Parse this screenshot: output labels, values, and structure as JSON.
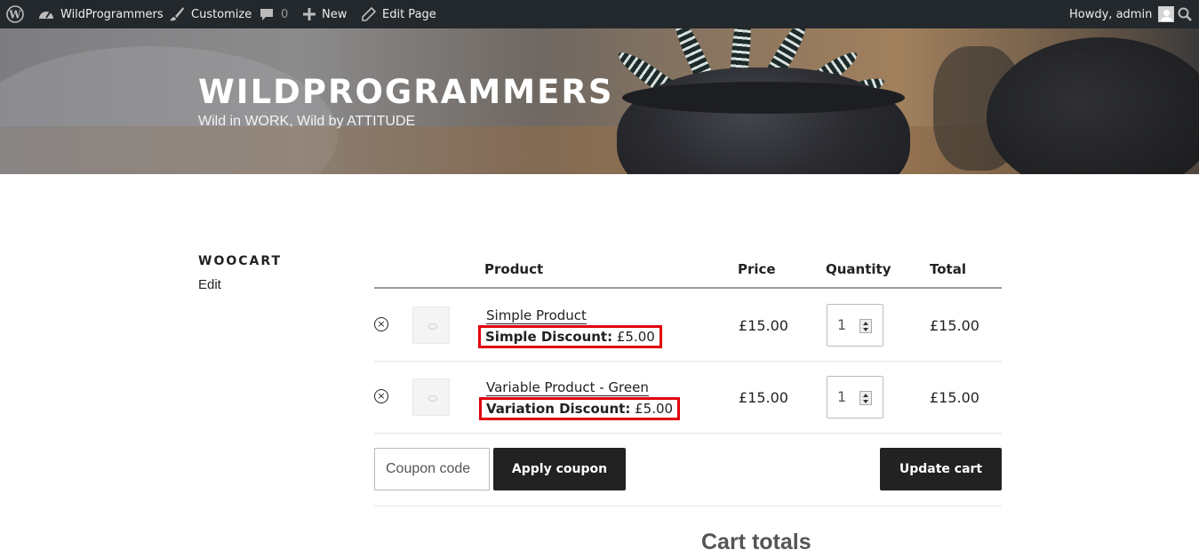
{
  "adminbar": {
    "site_name": "WildProgrammers",
    "customize": "Customize",
    "comments_count": "0",
    "new": "New",
    "edit_page": "Edit Page",
    "howdy": "Howdy, admin",
    "icons": [
      "wordpress-icon",
      "dashboard-icon",
      "brush-icon",
      "comment-icon",
      "plus-icon",
      "pencil-icon",
      "avatar",
      "search-icon"
    ]
  },
  "header": {
    "title": "WILDPROGRAMMERS",
    "tagline": "Wild in WORK, Wild by ATTITUDE"
  },
  "page": {
    "title": "WOOCART",
    "edit": "Edit"
  },
  "cart": {
    "headers": {
      "product": "Product",
      "price": "Price",
      "quantity": "Quantity",
      "total": "Total"
    },
    "items": [
      {
        "name": "Simple Product",
        "discount_label": "Simple Discount:",
        "discount_value": "£5.00",
        "price": "£15.00",
        "quantity": "1",
        "total": "£15.00"
      },
      {
        "name": "Variable Product - Green",
        "discount_label": "Variation Discount:",
        "discount_value": "£5.00",
        "price": "£15.00",
        "quantity": "1",
        "total": "£15.00"
      }
    ],
    "remove_symbol": "×",
    "coupon_placeholder": "Coupon code",
    "apply_coupon": "Apply coupon",
    "update_cart": "Update cart",
    "totals_title": "Cart totals"
  },
  "colors": {
    "adminbar": "#23282d",
    "button": "#222222",
    "highlight": "#e0000f"
  }
}
